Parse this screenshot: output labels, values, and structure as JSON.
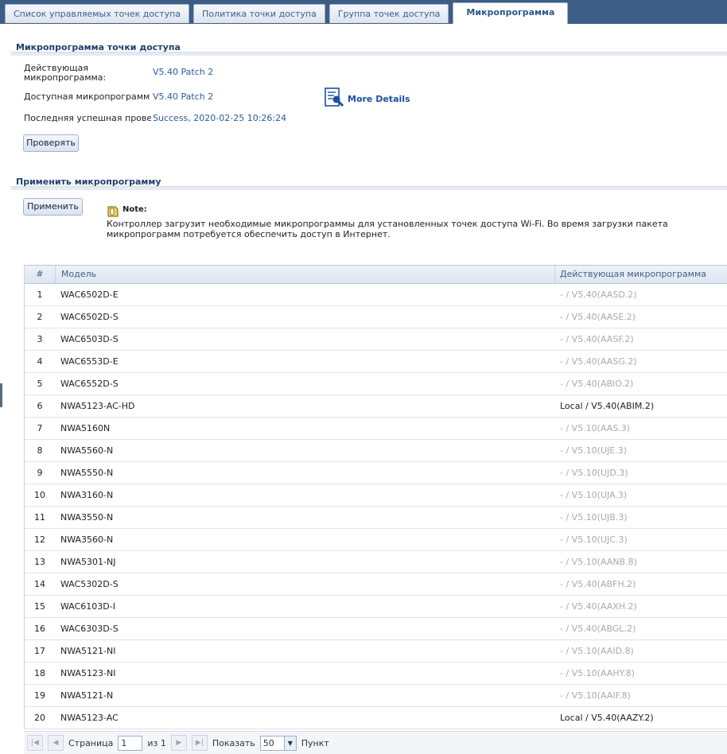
{
  "tabs": [
    {
      "label": "Список управляемых точек доступа"
    },
    {
      "label": "Политика точки доступа"
    },
    {
      "label": "Группа точек доступа"
    },
    {
      "label": "Микропрограмма"
    }
  ],
  "firmware_section": {
    "title": "Микропрограмма точки доступа",
    "current_label": "Действующая микропрограмма:",
    "current_value": "V5.40 Patch 2",
    "available_label": "Доступная микропрограмм",
    "available_value": "V5.40 Patch 2",
    "last_check_label": "Последняя успешная провер",
    "last_check_value": "Success, 2020-02-25 10:26:24",
    "more_details": "More Details",
    "check_button": "Проверять"
  },
  "apply_section": {
    "title": "Применить микропрограмму",
    "apply_button": "Применить",
    "note_title": "Note:",
    "note_text": "Контроллер загрузит необходимые микропрограммы для установленных точек доступа Wi-Fi. Во время загрузки пакета микропрограмм потребуется обеспечить доступ в Интернет."
  },
  "table": {
    "headers": {
      "num": "#",
      "model": "Модель",
      "firmware": "Действующая микропрограмма"
    },
    "rows": [
      {
        "num": "1",
        "model": "WAC6502D-E",
        "fw": "- / V5.40(AASD.2)",
        "local": false
      },
      {
        "num": "2",
        "model": "WAC6502D-S",
        "fw": "- / V5.40(AASE.2)",
        "local": false
      },
      {
        "num": "3",
        "model": "WAC6503D-S",
        "fw": "- / V5.40(AASF.2)",
        "local": false
      },
      {
        "num": "4",
        "model": "WAC6553D-E",
        "fw": "- / V5.40(AASG.2)",
        "local": false
      },
      {
        "num": "5",
        "model": "WAC6552D-S",
        "fw": "- / V5.40(ABIO.2)",
        "local": false
      },
      {
        "num": "6",
        "model": "NWA5123-AC-HD",
        "fw": "Local / V5.40(ABIM.2)",
        "local": true
      },
      {
        "num": "7",
        "model": "NWA5160N",
        "fw": "- / V5.10(AAS.3)",
        "local": false
      },
      {
        "num": "8",
        "model": "NWA5560-N",
        "fw": "- / V5.10(UJE.3)",
        "local": false
      },
      {
        "num": "9",
        "model": "NWA5550-N",
        "fw": "- / V5.10(UJD.3)",
        "local": false
      },
      {
        "num": "10",
        "model": "NWA3160-N",
        "fw": "- / V5.10(UJA.3)",
        "local": false
      },
      {
        "num": "11",
        "model": "NWA3550-N",
        "fw": "- / V5.10(UJB.3)",
        "local": false
      },
      {
        "num": "12",
        "model": "NWA3560-N",
        "fw": "- / V5.10(UJC.3)",
        "local": false
      },
      {
        "num": "13",
        "model": "NWA5301-NJ",
        "fw": "- / V5.10(AANB.8)",
        "local": false
      },
      {
        "num": "14",
        "model": "WAC5302D-S",
        "fw": "- / V5.40(ABFH.2)",
        "local": false
      },
      {
        "num": "15",
        "model": "WAC6103D-I",
        "fw": "- / V5.40(AAXH.2)",
        "local": false
      },
      {
        "num": "16",
        "model": "WAC6303D-S",
        "fw": "- / V5.40(ABGL.2)",
        "local": false
      },
      {
        "num": "17",
        "model": "NWA5121-NI",
        "fw": "- / V5.10(AAID.8)",
        "local": false
      },
      {
        "num": "18",
        "model": "NWA5123-NI",
        "fw": "- / V5.10(AAHY.8)",
        "local": false
      },
      {
        "num": "19",
        "model": "NWA5121-N",
        "fw": "- / V5.10(AAIF.8)",
        "local": false
      },
      {
        "num": "20",
        "model": "NWA5123-AC",
        "fw": "Local / V5.40(AAZY.2)",
        "local": true
      }
    ]
  },
  "pager": {
    "page_label": "Страница",
    "page_value": "1",
    "of_label": "из 1",
    "show_label": "Показать",
    "page_size": "50",
    "items_label": "Пункт"
  },
  "colors": {
    "accent": "#2a5aa0",
    "header_bar": "#3c5d86",
    "grey_text": "#aaaaaa"
  }
}
